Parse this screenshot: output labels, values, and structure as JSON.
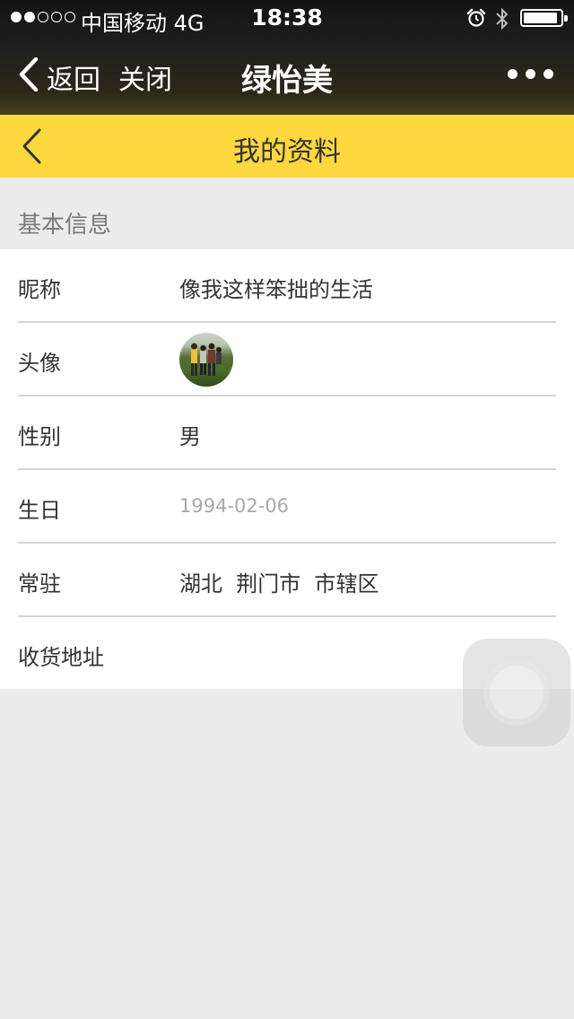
{
  "status_bar": {
    "carrier": "中国移动",
    "network": "4G",
    "time": "18:38",
    "signal_filled": 2,
    "signal_total": 5,
    "battery_level": 0.92
  },
  "nav": {
    "back_label": "返回",
    "close_label": "关闭",
    "title": "绿怡美",
    "more_icon": "more-icon"
  },
  "page": {
    "title": "我的资料"
  },
  "section": {
    "title": "基本信息"
  },
  "profile": {
    "rows": [
      {
        "label": "昵称",
        "value": "像我这样笨拙的生活"
      },
      {
        "label": "头像"
      },
      {
        "label": "性别",
        "value": "男"
      },
      {
        "label": "生日",
        "value": "1994-02-06"
      },
      {
        "label": "常驻",
        "value": "湖北  荆门市  市辖区"
      },
      {
        "label": "收货地址"
      }
    ]
  },
  "colors": {
    "accent": "#fdd83f",
    "background": "#ececec",
    "muted_text": "#a8a8a8"
  }
}
